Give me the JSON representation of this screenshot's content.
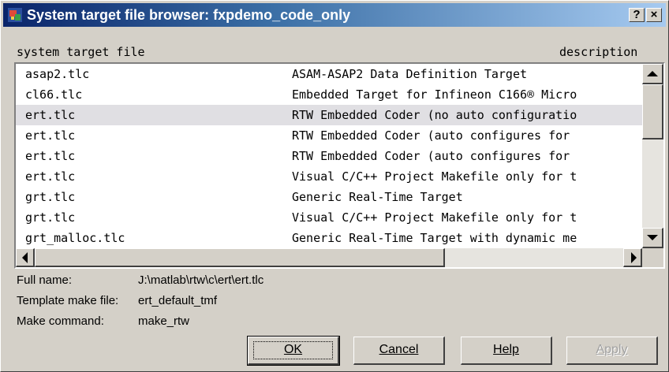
{
  "window": {
    "title": "System target file browser: fxpdemo_code_only",
    "help_button": "?",
    "close_button": "×"
  },
  "list": {
    "column_headers": {
      "file": "system target file",
      "description": "description"
    },
    "rows": [
      {
        "file": "asap2.tlc",
        "description": "ASAM-ASAP2 Data Definition Target"
      },
      {
        "file": "cl66.tlc",
        "description": "Embedded Target for Infineon C166® Micro"
      },
      {
        "file": "ert.tlc",
        "description": "RTW Embedded Coder (no auto configuratio",
        "selected": true
      },
      {
        "file": "ert.tlc",
        "description": "RTW Embedded Coder (auto configures for"
      },
      {
        "file": "ert.tlc",
        "description": "RTW Embedded Coder (auto configures for"
      },
      {
        "file": "ert.tlc",
        "description": "Visual C/C++ Project Makefile only for t"
      },
      {
        "file": "grt.tlc",
        "description": "Generic Real-Time Target"
      },
      {
        "file": "grt.tlc",
        "description": "Visual C/C++ Project Makefile only for t"
      },
      {
        "file": "grt_malloc.tlc",
        "description": "Generic Real-Time Target with dynamic me"
      }
    ]
  },
  "info": {
    "full_name_label": "Full name:",
    "full_name_value": "J:\\matlab\\rtw\\c\\ert\\ert.tlc",
    "template_label": "Template make file:",
    "template_value": "ert_default_tmf",
    "make_label": "Make command:",
    "make_value": "make_rtw"
  },
  "buttons": {
    "ok": "OK",
    "cancel": "Cancel",
    "help": "Help",
    "apply": "Apply"
  },
  "icons": {
    "app": "simulink-icon",
    "scroll_up": "arrow-up-icon",
    "scroll_down": "arrow-down-icon",
    "scroll_left": "arrow-left-icon",
    "scroll_right": "arrow-right-icon"
  },
  "colors": {
    "title_start": "#0a246a",
    "title_end": "#a6caf0",
    "selection": "#e0dfe3",
    "dialog_bg": "#d4d0c8"
  }
}
